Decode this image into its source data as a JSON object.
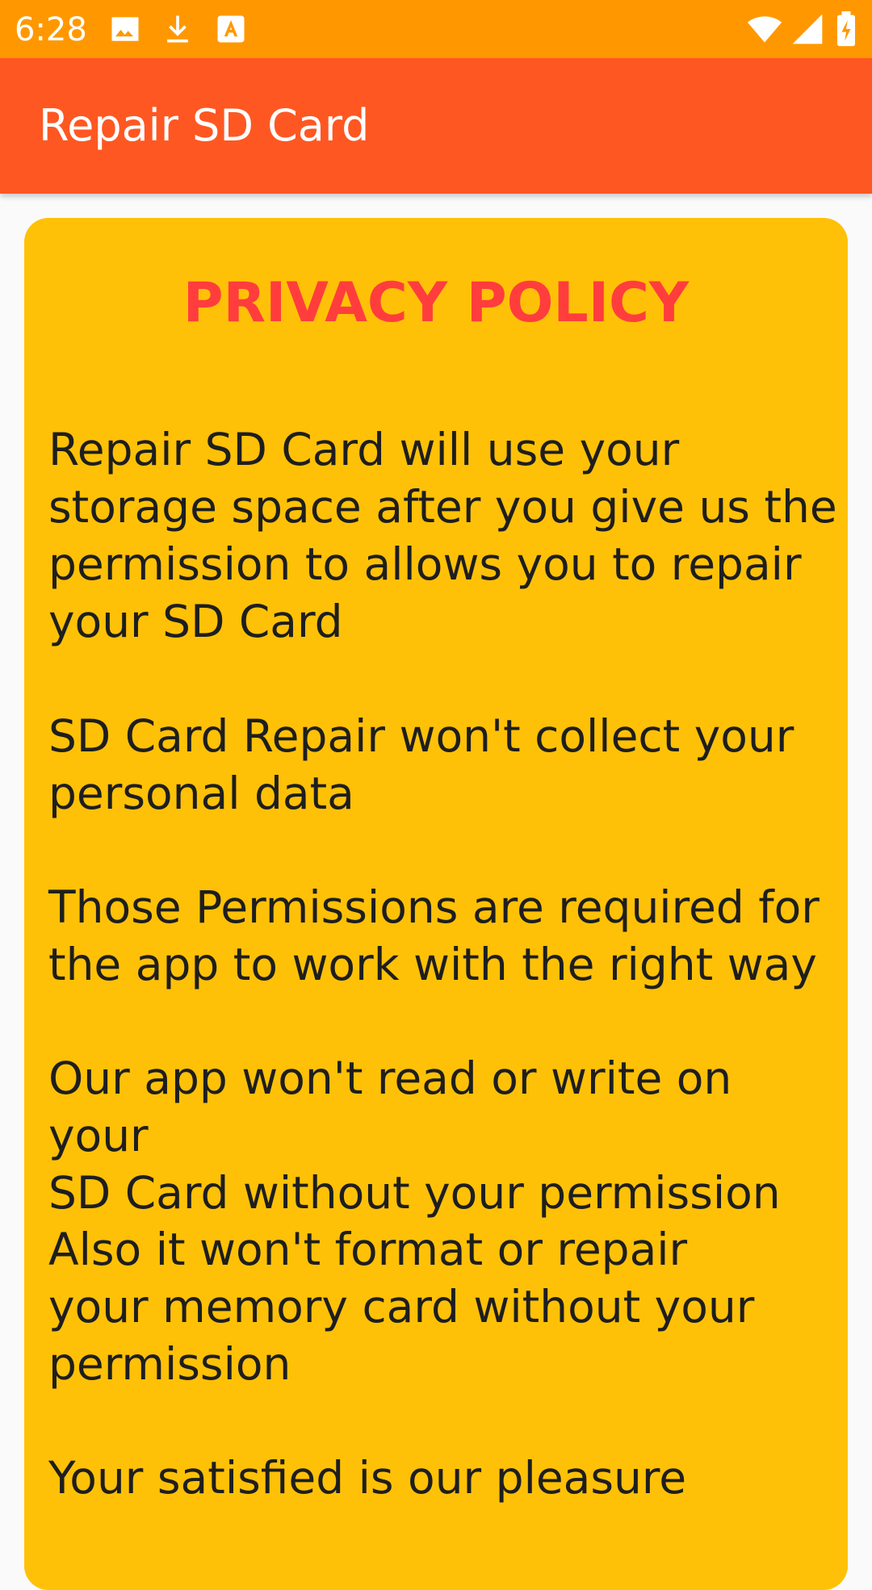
{
  "status_bar": {
    "time": "6:28",
    "left_icons": [
      "image-icon",
      "download-icon",
      "font-icon"
    ],
    "right_icons": [
      "wifi-icon",
      "signal-icon",
      "battery-charging-icon"
    ],
    "color": "#FF9800"
  },
  "app_bar": {
    "title": "Repair SD Card",
    "color": "#FF5722"
  },
  "card": {
    "color": "#FFC107",
    "title": "PRIVACY POLICY",
    "title_color": "#FF3D3D",
    "paragraphs": [
      "Repair SD Card will use your\nstorage space after you give us the\npermission to allows you to repair\nyour SD Card",
      "SD Card Repair won't collect your\npersonal data",
      "Those Permissions are required for\nthe app to work with the right way",
      "Our app won't read or write on your\nSD Card without your permission",
      "Also it won't format or repair\nyour memory card without your\npermission",
      "Your satisfied is our pleasure"
    ]
  }
}
